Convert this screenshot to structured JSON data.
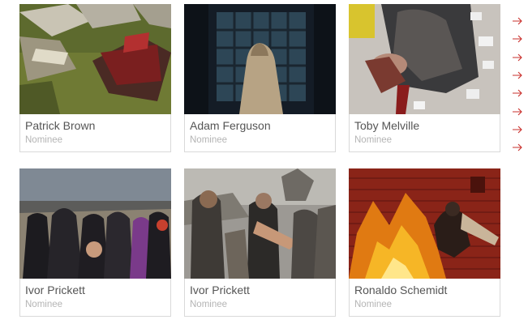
{
  "colors": {
    "accent": "#c9302c",
    "border": "#d9d9d9",
    "name": "#555555",
    "role": "#b4b4b4"
  },
  "cards": [
    {
      "name": "Patrick Brown",
      "role": "Nominee"
    },
    {
      "name": "Adam Ferguson",
      "role": "Nominee"
    },
    {
      "name": "Toby Melville",
      "role": "Nominee"
    },
    {
      "name": "Ivor Prickett",
      "role": "Nominee"
    },
    {
      "name": "Ivor Prickett",
      "role": "Nominee"
    },
    {
      "name": "Ronaldo Schemidt",
      "role": "Nominee"
    }
  ],
  "side_nav": {
    "icon": "arrow-right-icon",
    "count": 8
  }
}
